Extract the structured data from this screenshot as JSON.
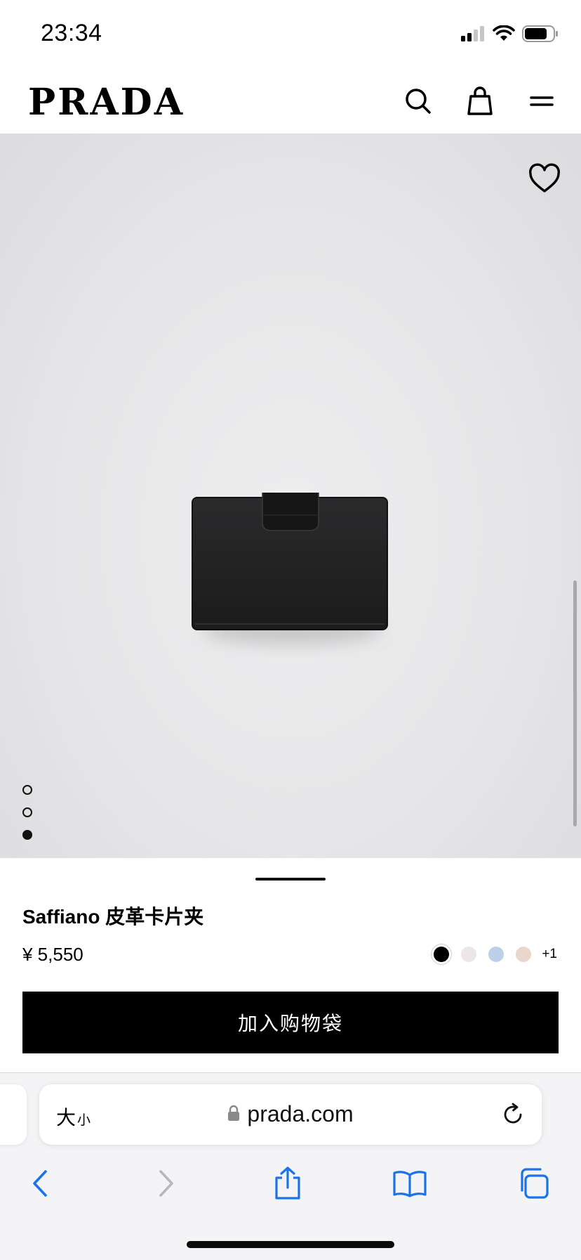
{
  "status": {
    "time": "23:34"
  },
  "header": {
    "brand": "PRADA"
  },
  "gallery": {
    "image_count": 3,
    "active_index": 2
  },
  "product": {
    "title": "Saffiano 皮革卡片夹",
    "price": "¥ 5,550",
    "color_swatches": [
      "#000000",
      "#ece6ea",
      "#bcd0ea",
      "#e9d7cc"
    ],
    "more_colors": "+1",
    "add_to_bag_label": "加入购物袋"
  },
  "browser": {
    "text_size_large": "大",
    "text_size_small": "小",
    "url": "prada.com"
  },
  "icons": {
    "status": [
      "cellular-signal-icon",
      "wifi-icon",
      "battery-icon"
    ],
    "header": [
      "search-icon",
      "shopping-bag-icon",
      "menu-icon"
    ],
    "product": [
      "heart-icon"
    ],
    "browser": [
      "lock-icon",
      "reload-icon",
      "back-icon",
      "forward-icon",
      "share-icon",
      "bookmarks-icon",
      "tabs-icon"
    ]
  }
}
